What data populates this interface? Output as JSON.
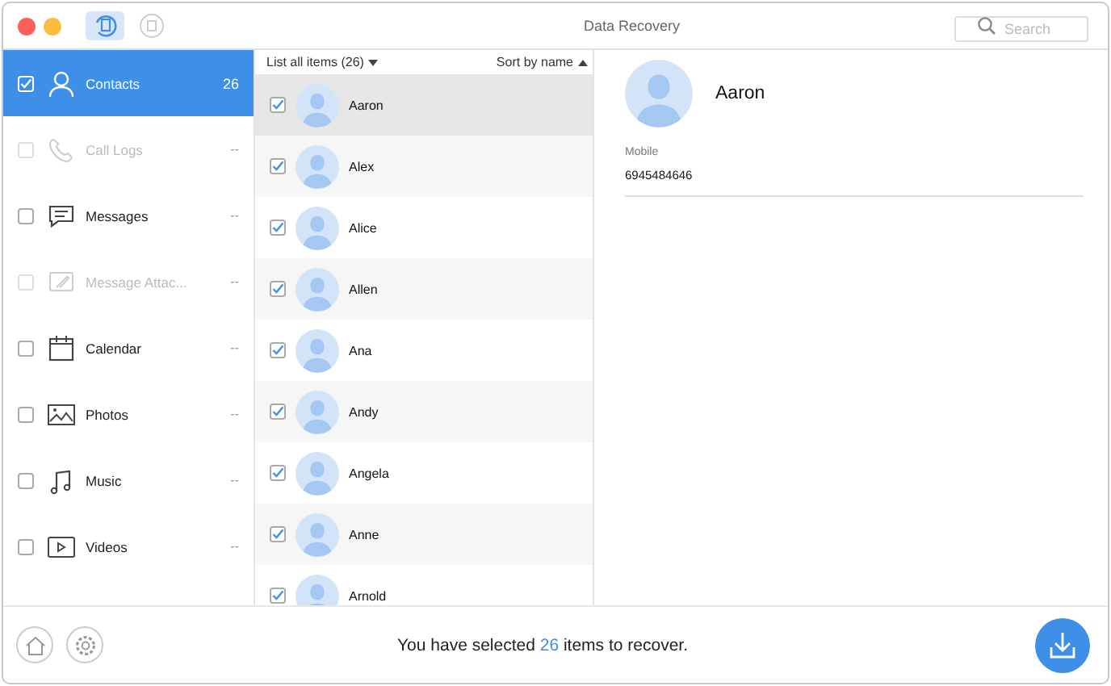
{
  "window": {
    "title": "Data Recovery",
    "search": {
      "placeholder": "Search"
    }
  },
  "sidebar": {
    "items": [
      {
        "kind": "contacts",
        "label": "Contacts",
        "count": "26",
        "checked": true,
        "selected": true,
        "disabled": false
      },
      {
        "kind": "call-logs",
        "label": "Call Logs",
        "count": "--",
        "checked": false,
        "selected": false,
        "disabled": true
      },
      {
        "kind": "messages",
        "label": "Messages",
        "count": "--",
        "checked": false,
        "selected": false,
        "disabled": false
      },
      {
        "kind": "attachments",
        "label": "Message Attac...",
        "count": "--",
        "checked": false,
        "selected": false,
        "disabled": true
      },
      {
        "kind": "calendar",
        "label": "Calendar",
        "count": "--",
        "checked": false,
        "selected": false,
        "disabled": false
      },
      {
        "kind": "photos",
        "label": "Photos",
        "count": "--",
        "checked": false,
        "selected": false,
        "disabled": false
      },
      {
        "kind": "music",
        "label": "Music",
        "count": "--",
        "checked": false,
        "selected": false,
        "disabled": false
      },
      {
        "kind": "videos",
        "label": "Videos",
        "count": "--",
        "checked": false,
        "selected": false,
        "disabled": false
      }
    ]
  },
  "list": {
    "filter": "List all items (26)",
    "sort": "Sort by name",
    "rows": [
      {
        "name": "Aaron",
        "checked": true,
        "selected": true
      },
      {
        "name": "Alex",
        "checked": true,
        "selected": false
      },
      {
        "name": "Alice",
        "checked": true,
        "selected": false
      },
      {
        "name": "Allen",
        "checked": true,
        "selected": false
      },
      {
        "name": "Ana",
        "checked": true,
        "selected": false
      },
      {
        "name": "Andy",
        "checked": true,
        "selected": false
      },
      {
        "name": "Angela",
        "checked": true,
        "selected": false
      },
      {
        "name": "Anne",
        "checked": true,
        "selected": false
      },
      {
        "name": "Arnold",
        "checked": true,
        "selected": false
      }
    ]
  },
  "detail": {
    "name": "Aaron",
    "fields": [
      {
        "label": "Mobile",
        "value": "6945484646"
      }
    ]
  },
  "footer": {
    "message": "You have selected **26** items to recover."
  }
}
